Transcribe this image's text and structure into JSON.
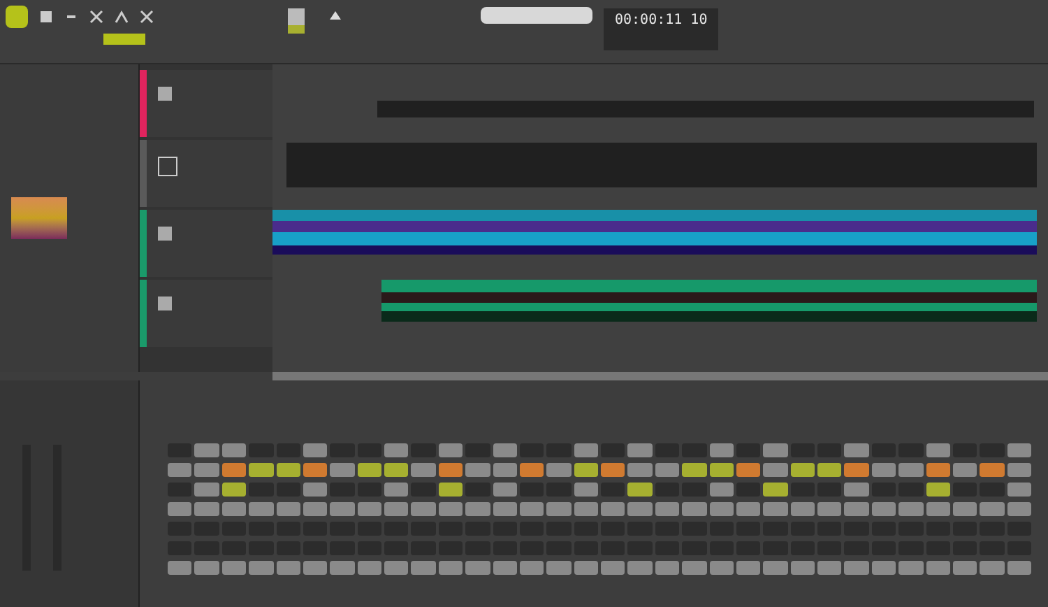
{
  "transport": {
    "time": "00:00:11 10"
  },
  "tracks": [
    {
      "color": "#e0245e",
      "kind": "audio"
    },
    {
      "color": "#5a5a5a",
      "kind": "instrument"
    },
    {
      "color": "#1a9a6a",
      "kind": "audio"
    },
    {
      "color": "#1a9a6a",
      "kind": "audio"
    }
  ],
  "lanes": [
    {
      "kind": "dark",
      "color": "#202020"
    },
    {
      "kind": "markers",
      "color": "#202020"
    },
    {
      "kind": "stripes",
      "color": "#1890a8"
    },
    {
      "kind": "wave",
      "color": "#16996a"
    }
  ],
  "step_rows": [
    {
      "steps": [
        {
          "kind": "off"
        },
        {
          "kind": "hit"
        },
        {
          "kind": "hit"
        },
        {
          "kind": "off"
        },
        {
          "kind": "off"
        },
        {
          "kind": "hit"
        },
        {
          "kind": "off"
        },
        {
          "kind": "off"
        },
        {
          "kind": "hit"
        },
        {
          "kind": "off"
        },
        {
          "kind": "hit"
        },
        {
          "kind": "off"
        },
        {
          "kind": "hit"
        },
        {
          "kind": "off"
        },
        {
          "kind": "off"
        },
        {
          "kind": "hit"
        },
        {
          "kind": "off"
        },
        {
          "kind": "hit"
        },
        {
          "kind": "off"
        },
        {
          "kind": "off"
        },
        {
          "kind": "hit"
        },
        {
          "kind": "off"
        },
        {
          "kind": "hit"
        },
        {
          "kind": "off"
        },
        {
          "kind": "off"
        },
        {
          "kind": "hit"
        },
        {
          "kind": "off"
        },
        {
          "kind": "off"
        },
        {
          "kind": "hit"
        },
        {
          "kind": "off"
        },
        {
          "kind": "off"
        },
        {
          "kind": "hit"
        }
      ]
    },
    {
      "steps": [
        {
          "kind": "hit"
        },
        {
          "kind": "hit"
        },
        {
          "kind": "accent"
        },
        {
          "kind": "ghost"
        },
        {
          "kind": "ghost"
        },
        {
          "kind": "accent"
        },
        {
          "kind": "hit"
        },
        {
          "kind": "ghost"
        },
        {
          "kind": "ghost"
        },
        {
          "kind": "hit"
        },
        {
          "kind": "accent"
        },
        {
          "kind": "hit"
        },
        {
          "kind": "hit"
        },
        {
          "kind": "accent"
        },
        {
          "kind": "hit"
        },
        {
          "kind": "ghost"
        },
        {
          "kind": "accent"
        },
        {
          "kind": "hit"
        },
        {
          "kind": "hit"
        },
        {
          "kind": "ghost"
        },
        {
          "kind": "ghost"
        },
        {
          "kind": "accent"
        },
        {
          "kind": "hit"
        },
        {
          "kind": "ghost"
        },
        {
          "kind": "ghost"
        },
        {
          "kind": "accent"
        },
        {
          "kind": "hit"
        },
        {
          "kind": "hit"
        },
        {
          "kind": "accent"
        },
        {
          "kind": "hit"
        },
        {
          "kind": "accent"
        },
        {
          "kind": "hit"
        }
      ]
    },
    {
      "steps": [
        {
          "kind": "off"
        },
        {
          "kind": "hit"
        },
        {
          "kind": "ghost"
        },
        {
          "kind": "off"
        },
        {
          "kind": "off"
        },
        {
          "kind": "hit"
        },
        {
          "kind": "off"
        },
        {
          "kind": "off"
        },
        {
          "kind": "hit"
        },
        {
          "kind": "off"
        },
        {
          "kind": "ghost"
        },
        {
          "kind": "off"
        },
        {
          "kind": "hit"
        },
        {
          "kind": "off"
        },
        {
          "kind": "off"
        },
        {
          "kind": "hit"
        },
        {
          "kind": "off"
        },
        {
          "kind": "ghost"
        },
        {
          "kind": "off"
        },
        {
          "kind": "off"
        },
        {
          "kind": "hit"
        },
        {
          "kind": "off"
        },
        {
          "kind": "ghost"
        },
        {
          "kind": "off"
        },
        {
          "kind": "off"
        },
        {
          "kind": "hit"
        },
        {
          "kind": "off"
        },
        {
          "kind": "off"
        },
        {
          "kind": "ghost"
        },
        {
          "kind": "off"
        },
        {
          "kind": "off"
        },
        {
          "kind": "hit"
        }
      ]
    },
    {
      "steps": [
        {
          "kind": "hit"
        },
        {
          "kind": "hit"
        },
        {
          "kind": "hit"
        },
        {
          "kind": "hit"
        },
        {
          "kind": "hit"
        },
        {
          "kind": "hit"
        },
        {
          "kind": "hit"
        },
        {
          "kind": "hit"
        },
        {
          "kind": "hit"
        },
        {
          "kind": "hit"
        },
        {
          "kind": "hit"
        },
        {
          "kind": "hit"
        },
        {
          "kind": "hit"
        },
        {
          "kind": "hit"
        },
        {
          "kind": "hit"
        },
        {
          "kind": "hit"
        },
        {
          "kind": "hit"
        },
        {
          "kind": "hit"
        },
        {
          "kind": "hit"
        },
        {
          "kind": "hit"
        },
        {
          "kind": "hit"
        },
        {
          "kind": "hit"
        },
        {
          "kind": "hit"
        },
        {
          "kind": "hit"
        },
        {
          "kind": "hit"
        },
        {
          "kind": "hit"
        },
        {
          "kind": "hit"
        },
        {
          "kind": "hit"
        },
        {
          "kind": "hit"
        },
        {
          "kind": "hit"
        },
        {
          "kind": "hit"
        },
        {
          "kind": "hit"
        }
      ]
    },
    {
      "steps": [
        {
          "kind": "off"
        },
        {
          "kind": "off"
        },
        {
          "kind": "off"
        },
        {
          "kind": "off"
        },
        {
          "kind": "off"
        },
        {
          "kind": "off"
        },
        {
          "kind": "off"
        },
        {
          "kind": "off"
        },
        {
          "kind": "off"
        },
        {
          "kind": "off"
        },
        {
          "kind": "off"
        },
        {
          "kind": "off"
        },
        {
          "kind": "off"
        },
        {
          "kind": "off"
        },
        {
          "kind": "off"
        },
        {
          "kind": "off"
        },
        {
          "kind": "off"
        },
        {
          "kind": "off"
        },
        {
          "kind": "off"
        },
        {
          "kind": "off"
        },
        {
          "kind": "off"
        },
        {
          "kind": "off"
        },
        {
          "kind": "off"
        },
        {
          "kind": "off"
        },
        {
          "kind": "off"
        },
        {
          "kind": "off"
        },
        {
          "kind": "off"
        },
        {
          "kind": "off"
        },
        {
          "kind": "off"
        },
        {
          "kind": "off"
        },
        {
          "kind": "off"
        },
        {
          "kind": "off"
        }
      ]
    },
    {
      "steps": [
        {
          "kind": "off"
        },
        {
          "kind": "off"
        },
        {
          "kind": "off"
        },
        {
          "kind": "off"
        },
        {
          "kind": "off"
        },
        {
          "kind": "off"
        },
        {
          "kind": "off"
        },
        {
          "kind": "off"
        },
        {
          "kind": "off"
        },
        {
          "kind": "off"
        },
        {
          "kind": "off"
        },
        {
          "kind": "off"
        },
        {
          "kind": "off"
        },
        {
          "kind": "off"
        },
        {
          "kind": "off"
        },
        {
          "kind": "off"
        },
        {
          "kind": "off"
        },
        {
          "kind": "off"
        },
        {
          "kind": "off"
        },
        {
          "kind": "off"
        },
        {
          "kind": "off"
        },
        {
          "kind": "off"
        },
        {
          "kind": "off"
        },
        {
          "kind": "off"
        },
        {
          "kind": "off"
        },
        {
          "kind": "off"
        },
        {
          "kind": "off"
        },
        {
          "kind": "off"
        },
        {
          "kind": "off"
        },
        {
          "kind": "off"
        },
        {
          "kind": "off"
        },
        {
          "kind": "off"
        }
      ]
    },
    {
      "steps": [
        {
          "kind": "hit"
        },
        {
          "kind": "hit"
        },
        {
          "kind": "hit"
        },
        {
          "kind": "hit"
        },
        {
          "kind": "hit"
        },
        {
          "kind": "hit"
        },
        {
          "kind": "hit"
        },
        {
          "kind": "hit"
        },
        {
          "kind": "hit"
        },
        {
          "kind": "hit"
        },
        {
          "kind": "hit"
        },
        {
          "kind": "hit"
        },
        {
          "kind": "hit"
        },
        {
          "kind": "hit"
        },
        {
          "kind": "hit"
        },
        {
          "kind": "hit"
        },
        {
          "kind": "hit"
        },
        {
          "kind": "hit"
        },
        {
          "kind": "hit"
        },
        {
          "kind": "hit"
        },
        {
          "kind": "hit"
        },
        {
          "kind": "hit"
        },
        {
          "kind": "hit"
        },
        {
          "kind": "hit"
        },
        {
          "kind": "hit"
        },
        {
          "kind": "hit"
        },
        {
          "kind": "hit"
        },
        {
          "kind": "hit"
        },
        {
          "kind": "hit"
        },
        {
          "kind": "hit"
        },
        {
          "kind": "hit"
        },
        {
          "kind": "hit"
        }
      ]
    }
  ]
}
